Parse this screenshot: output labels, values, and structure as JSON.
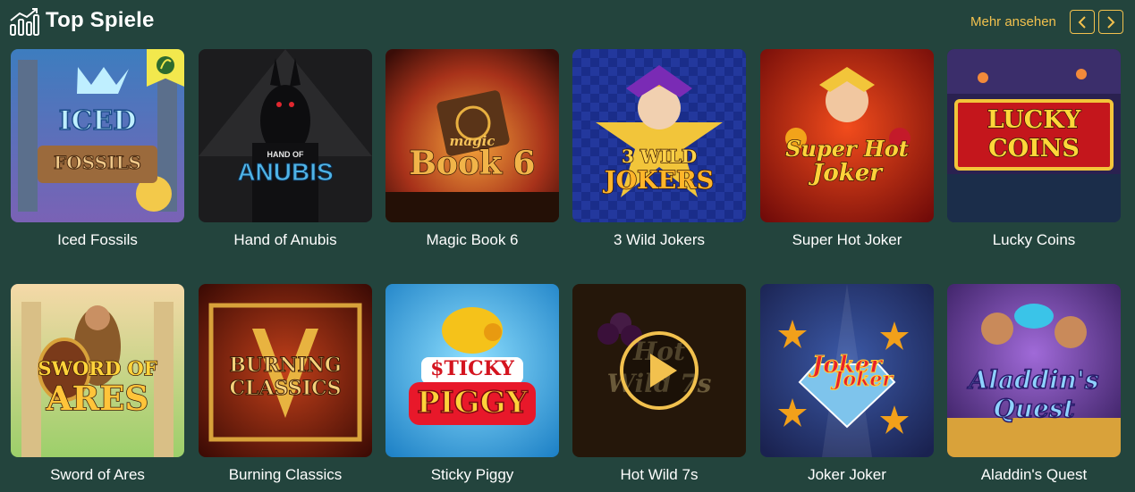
{
  "header": {
    "title": "Top Spiele",
    "icon": "bar-chart-trend-icon",
    "more_label": "Mehr ansehen",
    "prev_icon": "chevron-left-icon",
    "next_icon": "chevron-right-icon"
  },
  "colors": {
    "background": "#23443d",
    "accent": "#f2c14e",
    "text": "#ffffff"
  },
  "games": [
    {
      "name": "Iced Fossils",
      "art_lines": [
        "ICED",
        "FOSSILS"
      ],
      "badge": "new-leaf-badge-icon"
    },
    {
      "name": "Hand of Anubis",
      "art_lines": [
        "HAND OF",
        "ANUBIS"
      ]
    },
    {
      "name": "Magic Book 6",
      "art_lines": [
        "magic",
        "Book 6"
      ]
    },
    {
      "name": "3 Wild Jokers",
      "art_lines": [
        "3 WILD",
        "JOKERS"
      ]
    },
    {
      "name": "Super Hot Joker",
      "art_lines": [
        "Super Hot",
        "Joker"
      ]
    },
    {
      "name": "Lucky Coins",
      "art_lines": [
        "LUCKY",
        "COINS"
      ]
    },
    {
      "name": "Sword of Ares",
      "art_lines": [
        "SWORD OF",
        "ARES"
      ]
    },
    {
      "name": "Burning Classics",
      "art_lines": [
        "BURNING",
        "CLASSICS"
      ]
    },
    {
      "name": "Sticky Piggy",
      "art_lines": [
        "$TICKY",
        "PIGGY"
      ]
    },
    {
      "name": "Hot Wild 7s",
      "art_lines": [
        "Hot",
        "Wild 7s"
      ],
      "overlay": "play-button-icon"
    },
    {
      "name": "Joker Joker",
      "art_lines": [
        "Joker",
        "Joker"
      ]
    },
    {
      "name": "Aladdin's Quest",
      "art_lines": [
        "Aladdin's",
        "Quest"
      ]
    }
  ]
}
